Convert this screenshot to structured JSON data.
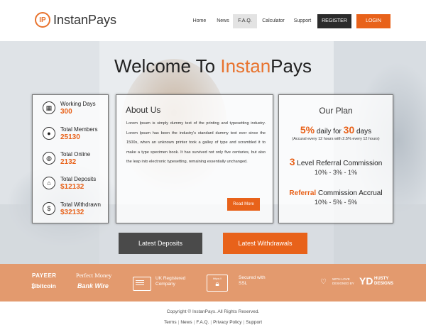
{
  "brand": {
    "name": "InstanPays",
    "logo_mark": "IP"
  },
  "nav": {
    "items": [
      "Home",
      "News",
      "F.A.Q.",
      "Calculator",
      "Support"
    ],
    "register": "REGISTER",
    "login": "LOGIN",
    "active": "F.A.Q."
  },
  "hero": {
    "title_prefix": "Welcome To ",
    "title_accent": "Instan",
    "title_suffix": "Pays"
  },
  "stats": [
    {
      "label": "Working Days",
      "value": "300",
      "icon": "calendar-icon"
    },
    {
      "label": "Total Members",
      "value": "25130",
      "icon": "user-icon"
    },
    {
      "label": "Total Online",
      "value": "2132",
      "icon": "globe-icon"
    },
    {
      "label": "Total Deposits",
      "value": "$12132",
      "icon": "bank-icon"
    },
    {
      "label": "Total Withdrawn",
      "value": "$32132",
      "icon": "money-bag-icon"
    }
  ],
  "about": {
    "title": "About Us",
    "text": "Lorem Ipsum is simply dummy text of the printing and typesetting industry. Lorem Ipsum has been the industry's standard dummy text ever since the 1500s, when an unknown printer took a galley of type and scrambled it to make a type specimen book. It has survived not only five centuries, but also the leap into electronic typesetting, remaining essentially unchanged.",
    "read_more": "Read More"
  },
  "plan": {
    "title": "Our Plan",
    "rate": "5%",
    "rate_text_1": " daily for ",
    "days": "30",
    "rate_text_2": " days",
    "accrual": "(Accural every 12 hours with 2.5% every 12 hours)",
    "levels": "3",
    "levels_text": " Level Referral Commission",
    "levels_values": "10% - 3% - 1%",
    "referral_word": "Referral",
    "referral_text": " Commission Accrual",
    "referral_values": "10% - 5% - 5%"
  },
  "actions": {
    "deposits": "Latest Deposits",
    "withdrawals": "Latest Withdrawals"
  },
  "band": {
    "payeer": "PAYEER",
    "bitcoin": "bitcoin",
    "perfect_money": "Perfect Money",
    "bank_wire": "Bank Wire",
    "uk_line1": "UK Registered",
    "uk_line2": "Company",
    "ssl_line1": "Secured with",
    "ssl_line2": "SSL",
    "ssl_badge": "https://",
    "with_love_1": "WITH LOVE",
    "with_love_2": "DESIGNED BY",
    "husty_logo": "YD",
    "husty_1": "HUSTY",
    "husty_2": "DESIGNS"
  },
  "footer": {
    "copyright": "Copyright © InstanPays. All Rights Reserved.",
    "links": [
      "Terms",
      "News",
      "F.A.Q.",
      "Privacy Policy",
      "Support"
    ]
  },
  "colors": {
    "accent": "#e8621a",
    "dark": "#2b2b2b",
    "band": "#e39a6e"
  }
}
